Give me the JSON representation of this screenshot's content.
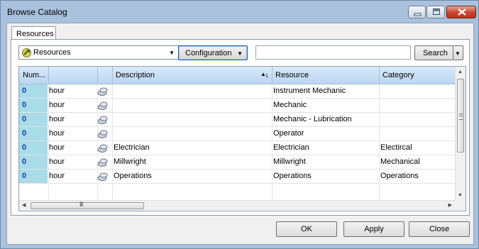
{
  "window": {
    "title": "Browse Catalog",
    "controls": [
      "minimize-icon",
      "maximize-icon",
      "close-icon"
    ]
  },
  "tabs": [
    {
      "label": "Resources",
      "active": true
    }
  ],
  "toolbar": {
    "type_select": {
      "value": "Resources",
      "icon": "resources-icon"
    },
    "configuration_label": "Configuration",
    "search_value": "",
    "search_label": "Search"
  },
  "grid": {
    "columns": [
      {
        "label": "Num..."
      },
      {
        "label": ""
      },
      {
        "label": ""
      },
      {
        "label": "Description",
        "sort": "ascending",
        "sort_index": "1"
      },
      {
        "label": "Resource"
      },
      {
        "label": "Category"
      }
    ],
    "rows": [
      {
        "num": "0",
        "unit": "hour",
        "icon": "resource-icon",
        "description": "",
        "resource": "Instrument Mechanic",
        "category": ""
      },
      {
        "num": "0",
        "unit": "hour",
        "icon": "resource-icon",
        "description": "",
        "resource": "Mechanic",
        "category": ""
      },
      {
        "num": "0",
        "unit": "hour",
        "icon": "resource-icon",
        "description": "",
        "resource": "Mechanic - Lubrication",
        "category": ""
      },
      {
        "num": "0",
        "unit": "hour",
        "icon": "resource-icon",
        "description": "",
        "resource": "Operator",
        "category": ""
      },
      {
        "num": "0",
        "unit": "hour",
        "icon": "resource-icon",
        "description": "Electrician",
        "resource": "Electrician",
        "category": "Electircal"
      },
      {
        "num": "0",
        "unit": "hour",
        "icon": "resource-icon",
        "description": "Millwright",
        "resource": "Millwright",
        "category": "Mechanical"
      },
      {
        "num": "0",
        "unit": "hour",
        "icon": "resource-icon",
        "description": "Operations",
        "resource": "Operations",
        "category": "Operations"
      }
    ],
    "hscroll_grip": "III"
  },
  "buttons": {
    "ok": "OK",
    "apply": "Apply",
    "close": "Close"
  },
  "colors": {
    "frame": "#a9c1dc",
    "header": "#c9e0f6",
    "num_cell": "#a9dbe9",
    "num_text": "#1a3ea8"
  }
}
